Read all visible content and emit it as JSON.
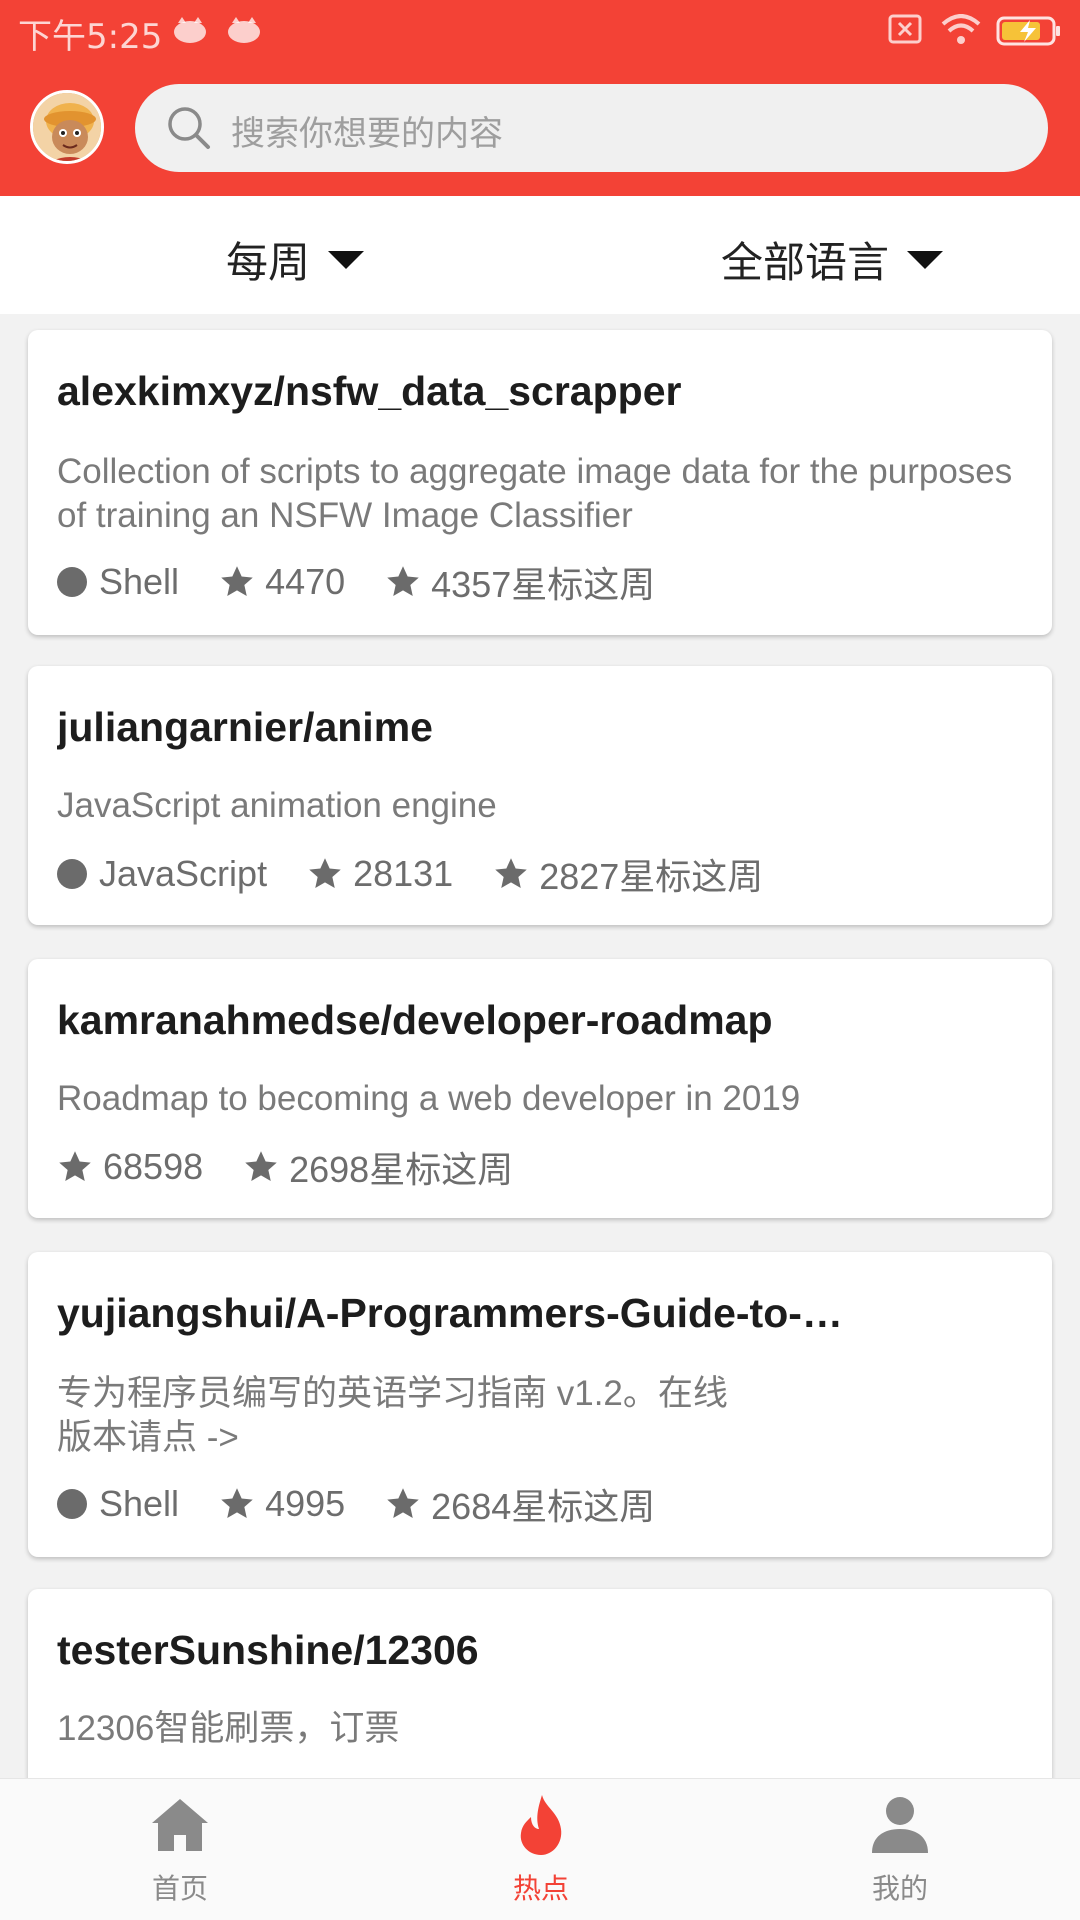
{
  "status_bar": {
    "time": "下午5:25"
  },
  "search": {
    "placeholder": "搜索你想要的内容"
  },
  "filters": {
    "period": "每周",
    "language": "全部语言"
  },
  "repos": [
    {
      "name": "alexkimxyz/nsfw_data_scrapper",
      "description": "Collection of scripts to aggregate image data for the purposes of training an NSFW Image Classifier",
      "language": "Shell",
      "stars": "4470",
      "weekly": "4357星标这周"
    },
    {
      "name": "juliangarnier/anime",
      "description": "JavaScript animation engine",
      "language": "JavaScript",
      "stars": "28131",
      "weekly": "2827星标这周"
    },
    {
      "name": "kamranahmedse/developer-roadmap",
      "description": "Roadmap to becoming a web developer in 2019",
      "language": "",
      "stars": "68598",
      "weekly": "2698星标这周"
    },
    {
      "name": "yujiangshui/A-Programmers-Guide-to-…",
      "description": "专为程序员编写的英语学习指南 v1.2。在线版本请点 ->",
      "language": "Shell",
      "stars": "4995",
      "weekly": "2684星标这周"
    },
    {
      "name": "testerSunshine/12306",
      "description": "12306智能刷票，订票",
      "language": "",
      "stars": "",
      "weekly": ""
    }
  ],
  "tabs": [
    {
      "label": "首页",
      "icon": "home-icon",
      "active": false
    },
    {
      "label": "热点",
      "icon": "fire-icon",
      "active": true
    },
    {
      "label": "我的",
      "icon": "person-icon",
      "active": false
    }
  ],
  "colors": {
    "primary": "#f34236",
    "inactive_tab": "#8a8a8a",
    "title": "#1d1d1d",
    "description": "#7a7a7a",
    "meta": "#6d6d6d"
  }
}
